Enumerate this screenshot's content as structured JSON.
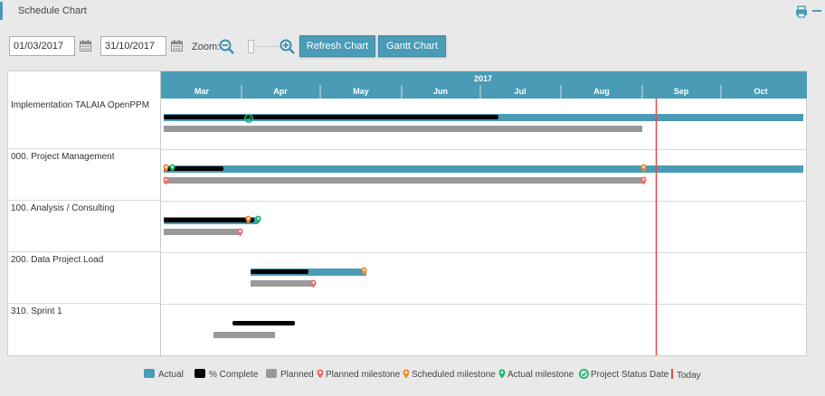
{
  "header": {
    "title": "Schedule Chart"
  },
  "toolbar": {
    "start_date": "01/03/2017",
    "end_date": "31/10/2017",
    "zoom_label": "Zoom:",
    "refresh_label": "Refresh Chart",
    "gantt_label": "Gantt Chart"
  },
  "colors": {
    "accent": "#4a9bb5",
    "actual": "#4a9bb5",
    "complete": "#000000",
    "planned": "#999999",
    "planned_milestone": "#f06a6a",
    "scheduled_milestone": "#f08c2a",
    "actual_milestone": "#1bb76e",
    "today": "#e8494f"
  },
  "timeline": {
    "year": "2017",
    "months": [
      "Mar",
      "Apr",
      "May",
      "Jun",
      "Jul",
      "Aug",
      "Sep",
      "Oct"
    ]
  },
  "tasks": [
    {
      "name": "Implementation TALAIA OpenPPM"
    },
    {
      "name": "000. Project Management"
    },
    {
      "name": "100. Analysis / Consulting"
    },
    {
      "name": "200. Data Project Load"
    },
    {
      "name": "310. Sprint 1"
    }
  ],
  "legend": [
    {
      "label": "Actual",
      "kind": "swatch",
      "color": "#4a9bb5"
    },
    {
      "label": "% Complete",
      "kind": "swatch",
      "color": "#000000"
    },
    {
      "label": "Planned",
      "kind": "swatch",
      "color": "#999999"
    },
    {
      "label": "Planned milestone",
      "kind": "pin",
      "color": "#f06a6a"
    },
    {
      "label": "Scheduled milestone",
      "kind": "pin",
      "color": "#f08c2a"
    },
    {
      "label": "Actual milestone",
      "kind": "pin",
      "color": "#1bb76e"
    },
    {
      "label": "Project Status Date",
      "kind": "check",
      "color": "#1bb76e"
    },
    {
      "label": "Today",
      "kind": "line",
      "color": "#e8494f"
    }
  ]
}
